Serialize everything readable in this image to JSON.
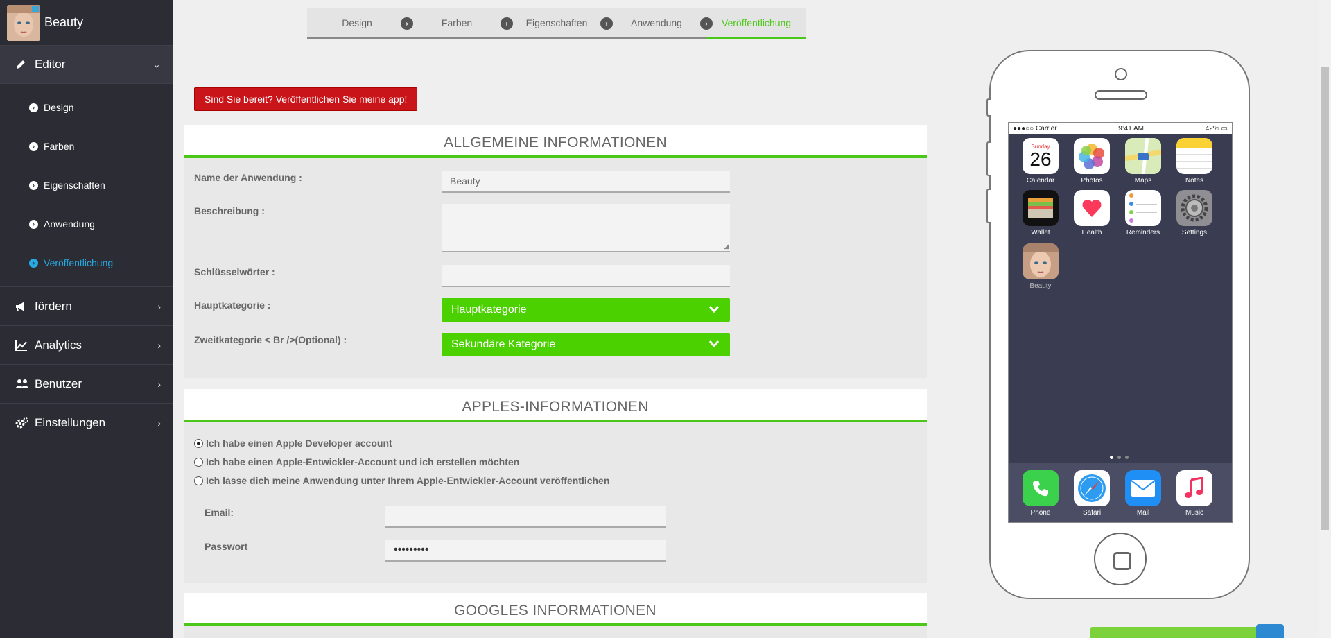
{
  "brand": {
    "name": "Beauty"
  },
  "sidebar": {
    "editor": {
      "label": "Editor"
    },
    "editor_items": [
      {
        "label": "Design"
      },
      {
        "label": "Farben"
      },
      {
        "label": "Eigenschaften"
      },
      {
        "label": "Anwendung"
      },
      {
        "label": "Veröffentlichung"
      }
    ],
    "sections": [
      {
        "label": "fördern"
      },
      {
        "label": "Analytics"
      },
      {
        "label": "Benutzer"
      },
      {
        "label": "Einstellungen"
      }
    ]
  },
  "steps": [
    {
      "label": "Design"
    },
    {
      "label": "Farben"
    },
    {
      "label": "Eigenschaften"
    },
    {
      "label": "Anwendung"
    },
    {
      "label": "Veröffentlichung"
    }
  ],
  "publish_button": "Sind Sie bereit? Veröffentlichen Sie meine app!",
  "general": {
    "title": "ALLGEMEINE INFORMATIONEN",
    "name_label": "Name der Anwendung :",
    "name_value": "Beauty",
    "description_label": "Beschreibung :",
    "keywords_label": "Schlüsselwörter :",
    "main_category_label": "Hauptkategorie :",
    "main_category_value": "Hauptkategorie",
    "second_category_label": "Zweitkategorie < Br />(Optional) :",
    "second_category_value": "Sekundäre Kategorie"
  },
  "apple": {
    "title": "APPLES-INFORMATIONEN",
    "options": [
      "Ich habe einen Apple Developer account",
      "Ich habe einen Apple-Entwickler-Account und ich erstellen möchten",
      "Ich lasse dich meine Anwendung unter Ihrem Apple-Entwickler-Account veröffentlichen"
    ],
    "selected_option": 0,
    "email_label": "Email:",
    "password_label": "Passwort",
    "password_value": "•••••••••"
  },
  "google": {
    "title": "GOOGLES INFORMATIONEN"
  },
  "phone": {
    "carrier": "●●●○○ Carrier",
    "time": "9:41 AM",
    "battery": "42%",
    "calendar_day": "Sunday",
    "calendar_date": "26",
    "apps": [
      "Calendar",
      "Photos",
      "Maps",
      "Notes",
      "Wallet",
      "Health",
      "Reminders",
      "Settings",
      "Beauty"
    ],
    "dock": [
      "Phone",
      "Safari",
      "Mail",
      "Music"
    ]
  },
  "colors": {
    "accent": "#4bc71a",
    "danger": "#c9141a",
    "sidebar": "#2c2c34",
    "link": "#27a9e1"
  }
}
